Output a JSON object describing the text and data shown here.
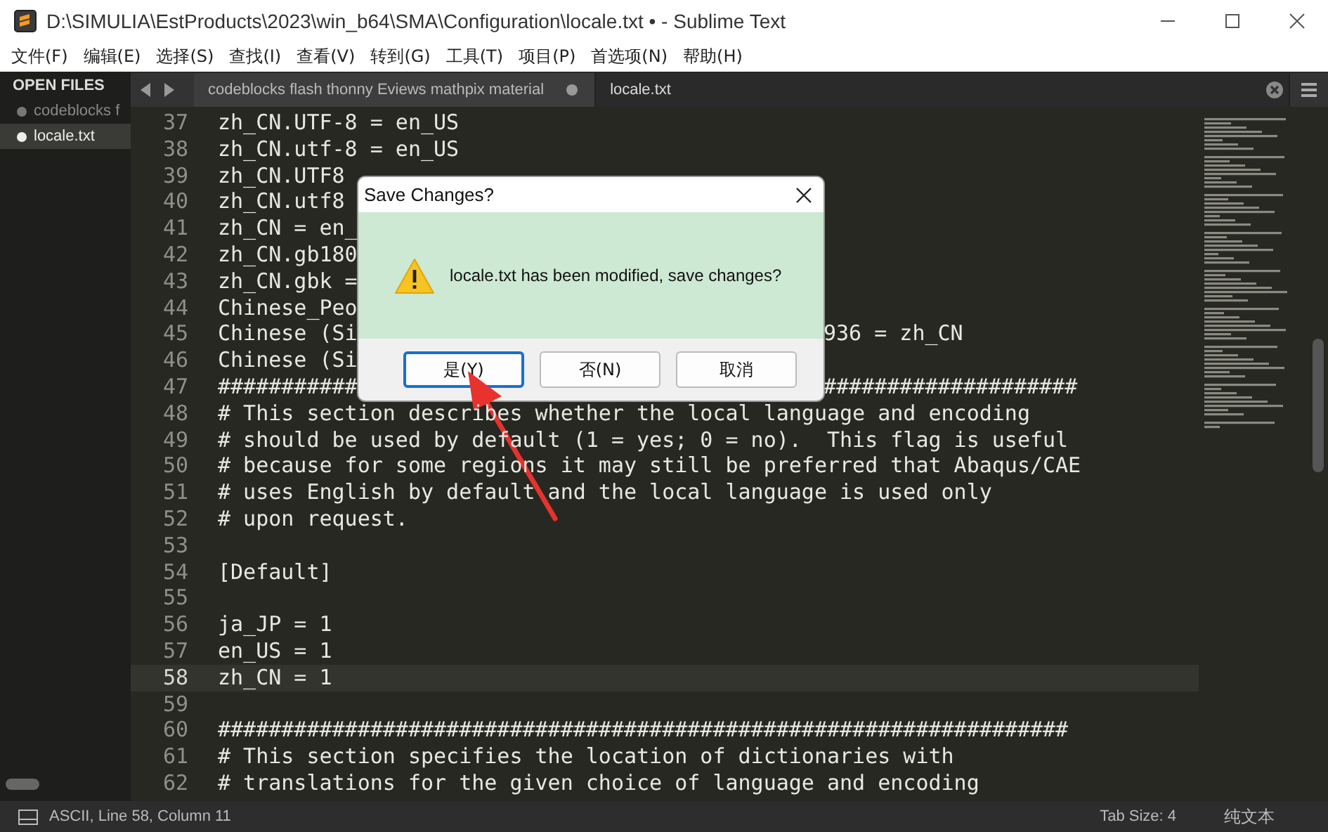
{
  "window": {
    "title": "D:\\SIMULIA\\EstProducts\\2023\\win_b64\\SMA\\Configuration\\locale.txt • - Sublime Text"
  },
  "menu": [
    "文件(F)",
    "编辑(E)",
    "选择(S)",
    "查找(I)",
    "查看(V)",
    "转到(G)",
    "工具(T)",
    "项目(P)",
    "首选项(N)",
    "帮助(H)"
  ],
  "sidebar": {
    "heading": "OPEN FILES",
    "items": [
      {
        "label": "codeblocks  f",
        "selected": false
      },
      {
        "label": "locale.txt",
        "selected": true
      }
    ]
  },
  "tabs": [
    {
      "label": "codeblocks  flash thonny  Eviews  mathpix material",
      "selected": false,
      "modified": true
    },
    {
      "label": "locale.txt",
      "selected": true,
      "modified": false
    }
  ],
  "editor": {
    "lines": [
      {
        "num": "37",
        "text": "zh_CN.UTF-8 = en_US",
        "current": false
      },
      {
        "num": "38",
        "text": "zh_CN.utf-8 = en_US",
        "current": false
      },
      {
        "num": "39",
        "text": "zh_CN.UTF8",
        "current": false
      },
      {
        "num": "40",
        "text": "zh_CN.utf8",
        "current": false
      },
      {
        "num": "41",
        "text": "zh_CN = en_",
        "current": false
      },
      {
        "num": "42",
        "text": "zh_CN.gb180",
        "current": false
      },
      {
        "num": "43",
        "text": "zh_CN.gbk =",
        "current": false
      },
      {
        "num": "44",
        "text": "Chinese_Peo",
        "current": false
      },
      {
        "num": "45",
        "text": "Chinese (Si",
        "right": "936 = zh_CN",
        "current": false
      },
      {
        "num": "46",
        "text": "Chinese (Si",
        "current": false
      },
      {
        "num": "47",
        "text": "###########",
        "right": "####################",
        "current": false
      },
      {
        "num": "48",
        "text": "# This section describes whether the local language and encoding",
        "current": false
      },
      {
        "num": "49",
        "text": "# should be used by default (1 = yes; 0 = no).  This flag is useful",
        "current": false
      },
      {
        "num": "50",
        "text": "# because for some regions it may still be preferred that Abaqus/CAE",
        "current": false
      },
      {
        "num": "51",
        "text": "# uses English by default and the local language is used only",
        "current": false
      },
      {
        "num": "52",
        "text": "# upon request.",
        "current": false
      },
      {
        "num": "53",
        "current": false
      },
      {
        "num": "54",
        "text": "[Default]",
        "current": false
      },
      {
        "num": "55",
        "current": false
      },
      {
        "num": "56",
        "text": "ja_JP = 1",
        "current": false
      },
      {
        "num": "57",
        "text": "en_US = 1",
        "current": false
      },
      {
        "num": "58",
        "text": "zh_CN = 1",
        "current": true
      },
      {
        "num": "59",
        "current": false
      },
      {
        "num": "60",
        "text": "###################################################################",
        "current": false
      },
      {
        "num": "61",
        "text": "# This section specifies the location of dictionaries with",
        "current": false
      },
      {
        "num": "62",
        "text": "# translations for the given choice of language and encoding",
        "current": false
      }
    ]
  },
  "dialog": {
    "title": "Save Changes?",
    "message": "locale.txt has been modified, save changes?",
    "buttons": [
      {
        "label": "是(Y)",
        "selected": true
      },
      {
        "label": "否(N)",
        "selected": false
      },
      {
        "label": "取消",
        "selected": false
      }
    ]
  },
  "status_bar": {
    "position": "ASCII, Line 58, Column 11",
    "tab_size": "Tab Size: 4",
    "syntax": "纯文本"
  }
}
